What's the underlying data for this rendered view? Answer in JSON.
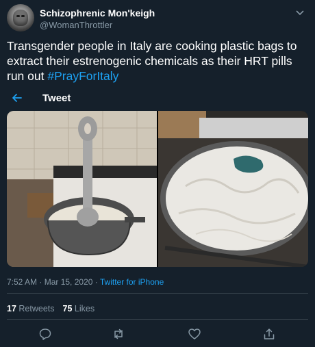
{
  "tweet": {
    "author_name": "Schizophrenic Mon'keigh",
    "author_handle": "@WomanThrottler",
    "text_main": "Transgender people in Italy are cooking plastic bags to extract their estrenogenic chemicals as their HRT pills run out ",
    "hashtag": "#PrayForItaly",
    "back_label": "Tweet",
    "time": "7:52 AM",
    "date": "Mar 15, 2020",
    "separator": " · ",
    "source": "Twitter for iPhone",
    "retweets_count": "17",
    "retweets_label": "Retweets",
    "likes_count": "75",
    "likes_label": "Likes"
  },
  "icons": {
    "caret": "chevron-down-icon",
    "back": "arrow-left-icon",
    "reply": "reply-icon",
    "retweet": "retweet-icon",
    "like": "heart-icon",
    "share": "share-icon"
  },
  "colors": {
    "background": "#15202b",
    "accent": "#1da1f2",
    "secondary_text": "#8899a6",
    "divider": "#38444d"
  }
}
